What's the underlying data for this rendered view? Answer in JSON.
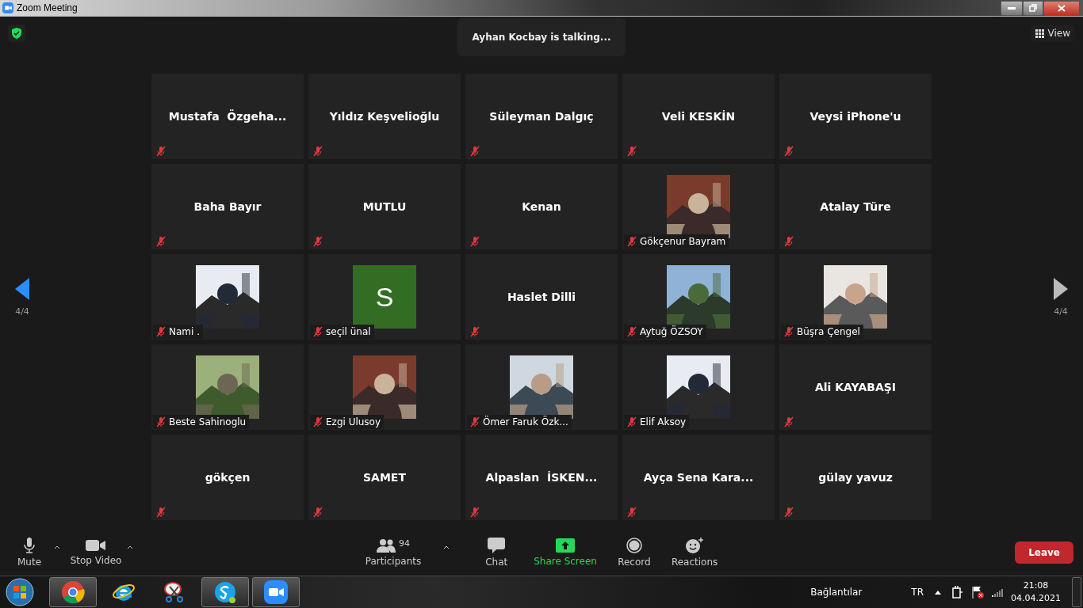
{
  "window": {
    "title": "Zoom Meeting"
  },
  "speaker_banner": "Ayhan Kocbay is talking...",
  "view_button": "View",
  "page_indicator_left": "4/4",
  "page_indicator_right": "4/4",
  "participants": [
    {
      "name": "Mustafa  Özgeha...",
      "kind": "name",
      "muted": true
    },
    {
      "name": "Yıldız Keşvelioğlu",
      "kind": "name",
      "muted": true
    },
    {
      "name": "Süleyman Dalgıç",
      "kind": "name",
      "muted": true
    },
    {
      "name": "Veli KESKİN",
      "kind": "name",
      "muted": true
    },
    {
      "name": "Veysi iPhone'u",
      "kind": "name",
      "muted": true
    },
    {
      "name": "Baha Bayır",
      "kind": "name",
      "muted": true
    },
    {
      "name": "MUTLU",
      "kind": "name",
      "muted": true
    },
    {
      "name": "Kenan",
      "kind": "name",
      "muted": true
    },
    {
      "name": "Gökçenur Bayram",
      "kind": "picture",
      "muted": true
    },
    {
      "name": "Atalay Türe",
      "kind": "name",
      "muted": true
    },
    {
      "name": "Nami .",
      "kind": "picture",
      "muted": true
    },
    {
      "name": "seçil ünal",
      "kind": "initial",
      "initial": "S",
      "muted": true
    },
    {
      "name": "Haslet Dilli",
      "kind": "name",
      "muted": true
    },
    {
      "name": "Aytuğ ÖZSOY",
      "kind": "picture",
      "muted": true
    },
    {
      "name": "Büşra Çengel",
      "kind": "picture",
      "muted": true
    },
    {
      "name": "Beste Sahinoglu",
      "kind": "picture",
      "muted": true
    },
    {
      "name": "Ezgi Ulusoy",
      "kind": "picture",
      "muted": true
    },
    {
      "name": "Ömer Faruk Özk...",
      "kind": "picture",
      "muted": true
    },
    {
      "name": "Elif Aksoy",
      "kind": "picture",
      "muted": true
    },
    {
      "name": "Ali KAYABAŞI",
      "kind": "name",
      "muted": true
    },
    {
      "name": "gökçen",
      "kind": "name",
      "muted": true
    },
    {
      "name": "SAMET",
      "kind": "name",
      "muted": true
    },
    {
      "name": "Alpaslan  İSKEN...",
      "kind": "name",
      "muted": true
    },
    {
      "name": "Ayça Sena Kara...",
      "kind": "name",
      "muted": true
    },
    {
      "name": "gülay yavuz",
      "kind": "name",
      "muted": true
    }
  ],
  "toolbar": {
    "left": [
      {
        "kind": "mic",
        "label": "Mute"
      },
      {
        "kind": "video",
        "label": "Stop Video"
      }
    ],
    "center": [
      {
        "kind": "participants",
        "label": "Participants",
        "count": "94"
      },
      {
        "kind": "chat",
        "label": "Chat"
      },
      {
        "kind": "share",
        "label": "Share Screen"
      },
      {
        "kind": "record",
        "label": "Record"
      },
      {
        "kind": "reactions",
        "label": "Reactions"
      }
    ],
    "leave": "Leave"
  },
  "taskbar": {
    "apps": [
      {
        "kind": "chrome",
        "running": true
      },
      {
        "kind": "ie",
        "running": false
      },
      {
        "kind": "snip",
        "running": false
      },
      {
        "kind": "skype",
        "running": true
      },
      {
        "kind": "zoom",
        "running": true
      }
    ],
    "toolbar_label": "Bağlantılar",
    "language": "TR",
    "time": "21:08",
    "date": "04.04.2021"
  }
}
